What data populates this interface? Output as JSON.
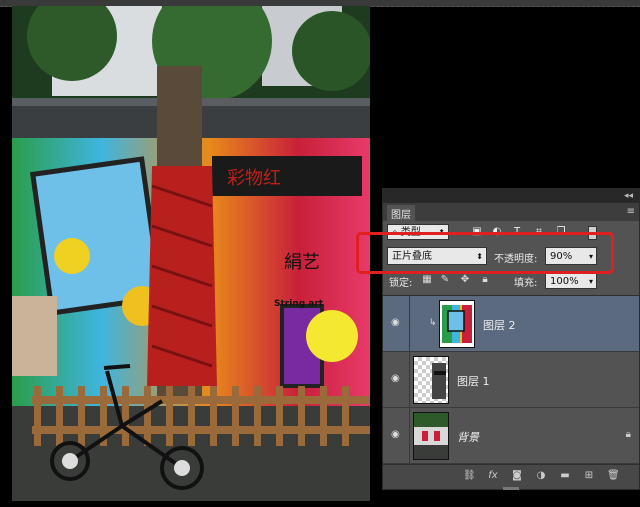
{
  "panel": {
    "tab_label": "图层",
    "collapse_glyph": "◂◂",
    "menu_glyph": "≡",
    "filter": {
      "kind_label": "类型",
      "kind_icon": "search-icon"
    },
    "blend_mode": "正片叠底",
    "opacity_label": "不透明度:",
    "opacity_value": "90%",
    "lock_label": "锁定:",
    "fill_label": "填充:",
    "fill_value": "100%",
    "layers": [
      {
        "name": "图层 2",
        "selected": true,
        "clipped": true
      },
      {
        "name": "图层 1",
        "selected": false,
        "clipped": false
      },
      {
        "name": "背景",
        "selected": false,
        "clipped": false,
        "locked": true
      }
    ]
  },
  "photo": {
    "sign_text": "絹艺",
    "sign_subtext": "String art",
    "banner_text": "彩物红"
  },
  "colors": {
    "panel_bg": "#535353",
    "selected_layer": "#5c6a80",
    "highlight_box": "#e02020"
  }
}
